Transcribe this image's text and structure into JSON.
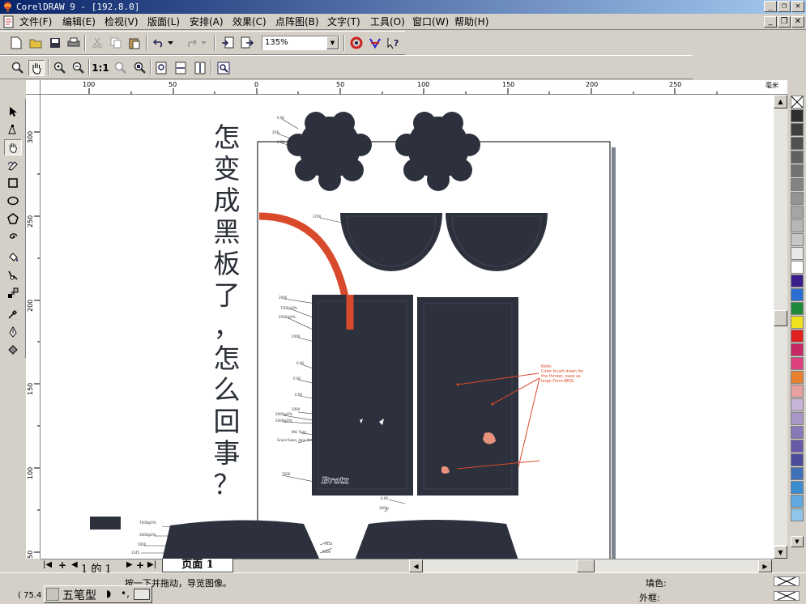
{
  "window": {
    "title": "CorelDRAW 9 - [192.8.0]"
  },
  "menu": [
    "文件(F)",
    "编辑(E)",
    "检视(V)",
    "版面(L)",
    "安排(A)",
    "效果(C)",
    "点阵图(B)",
    "文字(T)",
    "工具(O)",
    "窗口(W)",
    "帮助(H)"
  ],
  "toolbar": {
    "zoom_value": "135%"
  },
  "rulers": {
    "unit": "毫米",
    "horizontal_labels": [
      "100",
      "50",
      "0",
      "50",
      "100",
      "150",
      "200",
      "250"
    ],
    "vertical_labels": [
      "300",
      "250",
      "200",
      "150",
      "100",
      "50"
    ]
  },
  "canvas": {
    "headline_chars": [
      "怎",
      "变",
      "成",
      "黑",
      "板",
      "了",
      "，",
      "怎",
      "么",
      "回",
      "事",
      "？"
    ],
    "annotation": "Note: Color brush down for the throws, ease as large Form-BRIS.",
    "brand_text": "Bratz",
    "colors": {
      "garment": "#2c313d",
      "accent": "#d9492b",
      "annotation": "#d9492b"
    }
  },
  "page_nav": {
    "counter": "1 的 1",
    "tab_label": "页面  1"
  },
  "status": {
    "hint": "按一下并拖动，导览图像。",
    "fill_label": "填色:",
    "outline_label": "外框:",
    "coords": "( 75.4",
    "ime_name": "五笔型"
  },
  "palette_colors": [
    "#2e2e2e",
    "#3f3f3f",
    "#505050",
    "#616161",
    "#727272",
    "#838383",
    "#949494",
    "#a5a5a5",
    "#b6b6b6",
    "#c7c7c7",
    "#e8e8e8",
    "#ffffff",
    "#3a1e8c",
    "#2b6fd0",
    "#1e8a3a",
    "#f0e020",
    "#e02020",
    "#c82864",
    "#e04080",
    "#e88030",
    "#e8a0a0",
    "#c8b4d8",
    "#a898c8",
    "#8878b8",
    "#6858a8",
    "#4c4c9c",
    "#4070b8",
    "#3c8cd0",
    "#60a8e0",
    "#90c4e8"
  ]
}
